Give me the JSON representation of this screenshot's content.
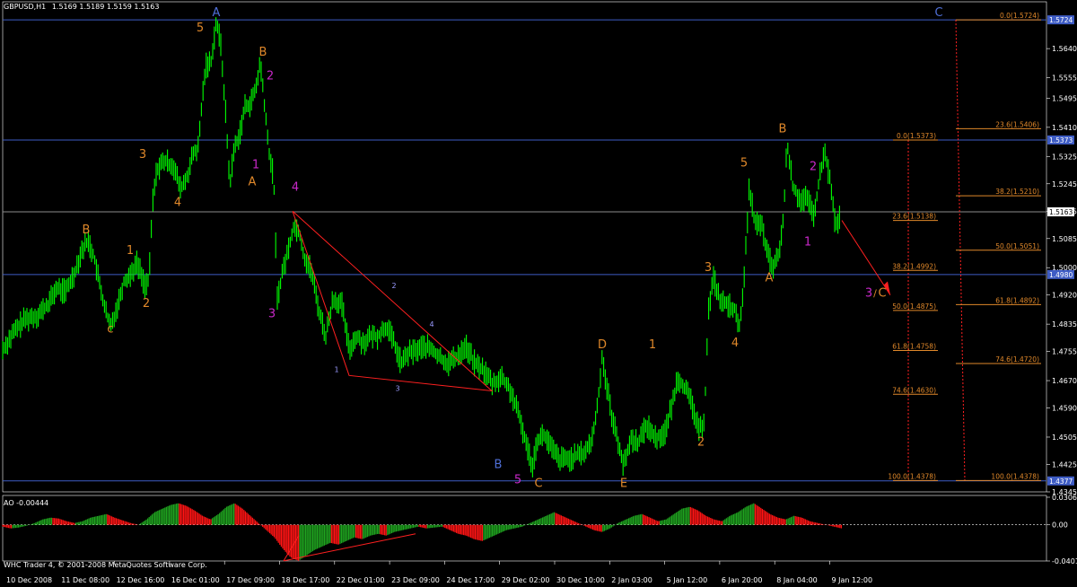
{
  "header": {
    "symbol_label": "GBPUSD,H1",
    "ohlc_label": "1.5169 1.5189 1.5159 1.5163"
  },
  "ao_panel": {
    "label": "AO -0.00444"
  },
  "copyright": "WHC Trader 4, © 2001-2008 MetaQuotes Software Corp.",
  "colors": {
    "background": "#000000",
    "grid": "#ffffff",
    "candle": "#00ff00",
    "hline_blue": "#3e5cc4",
    "hline_gray": "#8c8c8c",
    "fib": "#e0882a",
    "trend_red": "#ff2020",
    "wave_orange": "#e0882a",
    "wave_magenta": "#c828c8",
    "wave_blue": "#4f6fd8",
    "wave_gray_small": "#9a9aff",
    "ao_up": "#1fa31f",
    "ao_down": "#ff1414"
  },
  "chart_data": [
    {
      "type": "line",
      "title": "GBPUSD,H1",
      "y_axis_ticks": [
        "1.5640",
        "1.5555",
        "1.5495",
        "1.5410",
        "1.5325",
        "1.5245",
        "1.5165",
        "1.5085",
        "1.5000",
        "1.4920",
        "1.4835",
        "1.4755",
        "1.4670",
        "1.4590",
        "1.4505",
        "1.4425",
        "1.4345"
      ],
      "ylim": [
        1.4345,
        1.574
      ],
      "x_axis_ticks": [
        "10 Dec 2008",
        "11 Dec 08:00",
        "12 Dec 16:00",
        "16 Dec 01:00",
        "17 Dec 09:00",
        "18 Dec 17:00",
        "22 Dec 01:00",
        "23 Dec 09:00",
        "24 Dec 17:00",
        "29 Dec 02:00",
        "30 Dec 10:00",
        "2 Jan 03:00",
        "5 Jan 12:00",
        "6 Jan 20:00",
        "8 Jan 04:00",
        "9 Jan 12:00"
      ],
      "price_path": [
        [
          0,
          1.476
        ],
        [
          12,
          1.481
        ],
        [
          25,
          1.485
        ],
        [
          38,
          1.486
        ],
        [
          50,
          1.489
        ],
        [
          60,
          1.494
        ],
        [
          70,
          1.493
        ],
        [
          80,
          1.4985
        ],
        [
          88,
          1.505
        ],
        [
          95,
          1.508
        ],
        [
          102,
          1.503
        ],
        [
          108,
          1.495
        ],
        [
          115,
          1.487
        ],
        [
          120,
          1.4825
        ],
        [
          128,
          1.489
        ],
        [
          135,
          1.496
        ],
        [
          142,
          1.498
        ],
        [
          150,
          1.5015
        ],
        [
          158,
          1.495
        ],
        [
          163,
          1.496
        ],
        [
          167,
          1.519
        ],
        [
          172,
          1.529
        ],
        [
          180,
          1.531
        ],
        [
          190,
          1.53
        ],
        [
          198,
          1.523
        ],
        [
          205,
          1.526
        ],
        [
          212,
          1.533
        ],
        [
          218,
          1.535
        ],
        [
          222,
          1.548
        ],
        [
          226,
          1.559
        ],
        [
          232,
          1.56
        ],
        [
          238,
          1.572
        ],
        [
          243,
          1.565
        ],
        [
          248,
          1.547
        ],
        [
          253,
          1.524
        ],
        [
          258,
          1.535
        ],
        [
          264,
          1.539
        ],
        [
          270,
          1.547
        ],
        [
          276,
          1.548
        ],
        [
          282,
          1.552
        ],
        [
          287,
          1.56
        ],
        [
          292,
          1.547
        ],
        [
          296,
          1.535
        ],
        [
          302,
          1.526
        ],
        [
          306,
          1.491
        ],
        [
          312,
          1.499
        ],
        [
          318,
          1.505
        ],
        [
          324,
          1.512
        ],
        [
          330,
          1.511
        ],
        [
          336,
          1.503
        ],
        [
          344,
          1.499
        ],
        [
          352,
          1.488
        ],
        [
          360,
          1.48
        ],
        [
          368,
          1.491
        ],
        [
          378,
          1.489
        ],
        [
          386,
          1.476
        ],
        [
          394,
          1.48
        ],
        [
          402,
          1.478
        ],
        [
          410,
          1.48
        ],
        [
          418,
          1.48
        ],
        [
          428,
          1.483
        ],
        [
          436,
          1.478
        ],
        [
          444,
          1.472
        ],
        [
          452,
          1.475
        ],
        [
          462,
          1.476
        ],
        [
          470,
          1.477
        ],
        [
          478,
          1.476
        ],
        [
          486,
          1.474
        ],
        [
          496,
          1.472
        ],
        [
          506,
          1.474
        ],
        [
          516,
          1.477
        ],
        [
          526,
          1.472
        ],
        [
          536,
          1.47
        ],
        [
          546,
          1.466
        ],
        [
          556,
          1.468
        ],
        [
          566,
          1.464
        ],
        [
          576,
          1.456
        ],
        [
          584,
          1.448
        ],
        [
          590,
          1.442
        ],
        [
          596,
          1.45
        ],
        [
          604,
          1.451
        ],
        [
          612,
          1.447
        ],
        [
          620,
          1.444
        ],
        [
          630,
          1.444
        ],
        [
          640,
          1.445
        ],
        [
          648,
          1.446
        ],
        [
          656,
          1.449
        ],
        [
          662,
          1.458
        ],
        [
          668,
          1.474
        ],
        [
          674,
          1.464
        ],
        [
          680,
          1.455
        ],
        [
          686,
          1.449
        ],
        [
          692,
          1.442
        ],
        [
          700,
          1.45
        ],
        [
          708,
          1.449
        ],
        [
          718,
          1.454
        ],
        [
          728,
          1.45
        ],
        [
          738,
          1.452
        ],
        [
          746,
          1.46
        ],
        [
          752,
          1.468
        ],
        [
          760,
          1.465
        ],
        [
          768,
          1.46
        ],
        [
          776,
          1.452
        ],
        [
          782,
          1.456
        ],
        [
          786,
          1.487
        ],
        [
          792,
          1.497
        ],
        [
          800,
          1.49
        ],
        [
          808,
          1.489
        ],
        [
          816,
          1.488
        ],
        [
          820,
          1.481
        ],
        [
          826,
          1.496
        ],
        [
          832,
          1.524
        ],
        [
          838,
          1.513
        ],
        [
          846,
          1.512
        ],
        [
          852,
          1.504
        ],
        [
          858,
          1.5
        ],
        [
          864,
          1.503
        ],
        [
          870,
          1.514
        ],
        [
          874,
          1.537
        ],
        [
          880,
          1.524
        ],
        [
          888,
          1.52
        ],
        [
          896,
          1.52
        ],
        [
          904,
          1.515
        ],
        [
          910,
          1.526
        ],
        [
          916,
          1.534
        ],
        [
          922,
          1.525
        ],
        [
          928,
          1.512
        ],
        [
          934,
          1.515
        ]
      ],
      "horizontal_levels": [
        {
          "price": 1.5724,
          "style": "blue",
          "label": "1.5724"
        },
        {
          "price": 1.5373,
          "style": "blue",
          "label": "1.5373"
        },
        {
          "price": 1.5163,
          "style": "gray",
          "label": "1.5163"
        },
        {
          "price": 1.498,
          "style": "blue",
          "label": "1.4980"
        },
        {
          "price": 1.4377,
          "style": "blue",
          "label": "1.4377"
        }
      ],
      "fib_set_1": [
        {
          "label": "0.0(1.5373)",
          "price": 1.5373
        },
        {
          "label": "23.6(1.5138)",
          "price": 1.5138
        },
        {
          "label": "38.2(1.4992)",
          "price": 1.4992
        },
        {
          "label": "50.0(1.4875)",
          "price": 1.4875
        },
        {
          "label": "61.8(1.4758)",
          "price": 1.4758
        },
        {
          "label": "74.6(1.4630)",
          "price": 1.463
        },
        {
          "label": "100.0(1.4378)",
          "price": 1.4378
        }
      ],
      "fib_set_2": [
        {
          "label": "0.0(1.5724)",
          "price": 1.5724
        },
        {
          "label": "23.6(1.5406)",
          "price": 1.5406
        },
        {
          "label": "38.2(1.5210)",
          "price": 1.521
        },
        {
          "label": "50.0(1.5051)",
          "price": 1.5051
        },
        {
          "label": "61.8(1.4892)",
          "price": 1.4892
        },
        {
          "label": "74.6(1.4720)",
          "price": 1.472
        },
        {
          "label": "100.0(1.4378)",
          "price": 1.4378
        }
      ],
      "wave_labels": [
        {
          "text": "A",
          "price": 1.5735,
          "idx": 238,
          "color": "wave_blue"
        },
        {
          "text": "5",
          "price": 1.569,
          "idx": 220,
          "color": "wave_orange"
        },
        {
          "text": "B",
          "price": 1.562,
          "idx": 290,
          "color": "wave_orange"
        },
        {
          "text": "2",
          "price": 1.555,
          "idx": 298,
          "color": "wave_magenta"
        },
        {
          "text": "3",
          "price": 1.532,
          "idx": 156,
          "color": "wave_orange"
        },
        {
          "text": "1",
          "price": 1.529,
          "idx": 282,
          "color": "wave_magenta"
        },
        {
          "text": "A",
          "price": 1.524,
          "idx": 278,
          "color": "wave_orange"
        },
        {
          "text": "4",
          "price": 1.518,
          "idx": 195,
          "color": "wave_orange"
        },
        {
          "text": "4",
          "price": 1.5225,
          "idx": 326,
          "color": "wave_magenta"
        },
        {
          "text": "B",
          "price": 1.51,
          "idx": 93,
          "color": "wave_orange"
        },
        {
          "text": "1",
          "price": 1.504,
          "idx": 142,
          "color": "wave_orange"
        },
        {
          "text": "2",
          "price": 1.4885,
          "idx": 160,
          "color": "wave_orange"
        },
        {
          "text": "c",
          "price": 1.481,
          "idx": 120,
          "color": "wave_orange"
        },
        {
          "text": "3",
          "price": 1.4855,
          "idx": 300,
          "color": "wave_magenta"
        },
        {
          "text": "2",
          "price": 1.494,
          "idx": 436,
          "color": "wave_gray_small"
        },
        {
          "text": "4",
          "price": 1.4828,
          "idx": 478,
          "color": "wave_gray_small"
        },
        {
          "text": "1",
          "price": 1.4695,
          "idx": 372,
          "color": "wave_gray_small"
        },
        {
          "text": "3",
          "price": 1.464,
          "idx": 440,
          "color": "wave_gray_small"
        },
        {
          "text": "D",
          "price": 1.4765,
          "idx": 668,
          "color": "wave_orange"
        },
        {
          "text": "1",
          "price": 1.4765,
          "idx": 724,
          "color": "wave_orange"
        },
        {
          "text": "B",
          "price": 1.4415,
          "idx": 552,
          "color": "wave_blue"
        },
        {
          "text": "5",
          "price": 1.437,
          "idx": 574,
          "color": "wave_magenta"
        },
        {
          "text": "C",
          "price": 1.436,
          "idx": 597,
          "color": "wave_orange"
        },
        {
          "text": "E",
          "price": 1.436,
          "idx": 692,
          "color": "wave_orange"
        },
        {
          "text": "2",
          "price": 1.448,
          "idx": 778,
          "color": "wave_orange"
        },
        {
          "text": "3",
          "price": 1.499,
          "idx": 786,
          "color": "wave_orange"
        },
        {
          "text": "4",
          "price": 1.477,
          "idx": 816,
          "color": "wave_orange"
        },
        {
          "text": "5",
          "price": 1.5295,
          "idx": 826,
          "color": "wave_orange"
        },
        {
          "text": "A",
          "price": 1.496,
          "idx": 854,
          "color": "wave_orange"
        },
        {
          "text": "B",
          "price": 1.5395,
          "idx": 869,
          "color": "wave_orange"
        },
        {
          "text": "2",
          "price": 1.5285,
          "idx": 903,
          "color": "wave_magenta"
        },
        {
          "text": "1",
          "price": 1.5065,
          "idx": 897,
          "color": "wave_magenta"
        },
        {
          "text": "C",
          "price": 1.5735,
          "idx": 1043,
          "color": "wave_blue"
        }
      ],
      "target_label": {
        "prefix": "3",
        "sep": "/",
        "suffix": "C"
      }
    },
    {
      "type": "bar",
      "title": "AO -0.00444",
      "y_axis_ticks": [
        "0.03062",
        "0.00",
        "-0.04014"
      ],
      "ylim": [
        -0.04014,
        0.03062
      ],
      "values_sample": [
        -0.002,
        -0.004,
        -0.003,
        -0.001,
        0.002,
        0.006,
        0.008,
        0.007,
        0.004,
        0.002,
        0.004,
        0.008,
        0.01,
        0.012,
        0.008,
        0.005,
        0.002,
        0.0,
        0.006,
        0.014,
        0.018,
        0.022,
        0.024,
        0.021,
        0.016,
        0.01,
        0.006,
        0.012,
        0.02,
        0.024,
        0.018,
        0.01,
        0.002,
        -0.006,
        -0.014,
        -0.026,
        -0.036,
        -0.04,
        -0.034,
        -0.028,
        -0.024,
        -0.02,
        -0.022,
        -0.018,
        -0.014,
        -0.016,
        -0.012,
        -0.01,
        -0.012,
        -0.008,
        -0.006,
        -0.004,
        -0.002,
        -0.004,
        -0.003,
        -0.002,
        -0.006,
        -0.01,
        -0.012,
        -0.016,
        -0.018,
        -0.014,
        -0.01,
        -0.006,
        -0.004,
        -0.002,
        0.002,
        0.006,
        0.01,
        0.014,
        0.01,
        0.006,
        0.002,
        -0.002,
        -0.006,
        -0.008,
        -0.004,
        0.002,
        0.006,
        0.01,
        0.012,
        0.008,
        0.004,
        0.006,
        0.012,
        0.018,
        0.02,
        0.016,
        0.01,
        0.006,
        0.004,
        0.01,
        0.014,
        0.02,
        0.024,
        0.018,
        0.012,
        0.008,
        0.006,
        0.01,
        0.008,
        0.004,
        0.002,
        0.0,
        -0.002,
        -0.004
      ]
    }
  ]
}
